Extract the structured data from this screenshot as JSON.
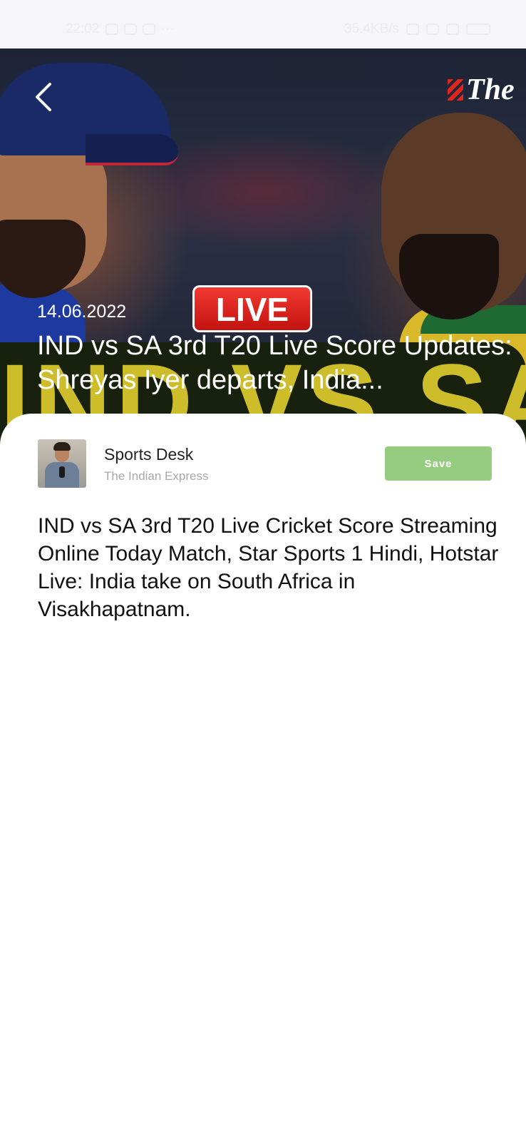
{
  "status_bar": {
    "time": "22:02",
    "more_indicator": "···",
    "net_speed": "35.4KB/s",
    "icons": [
      "whatsapp-icon",
      "game-icon",
      "message-icon",
      "alarm-icon",
      "signal-icon",
      "wifi-icon",
      "battery-icon"
    ]
  },
  "hero": {
    "logo_text": "The",
    "live_badge": "LIVE",
    "band_text": "IND VS SA",
    "date": "14.06.2022",
    "title": "IND vs SA 3rd T20 Live Score Updates: Shreyas Iyer departs, India..."
  },
  "author": {
    "name": "Sports Desk",
    "source": "The Indian Express"
  },
  "actions": {
    "save_label": "Save"
  },
  "article": {
    "body": "IND vs SA 3rd T20 Live Cricket Score Streaming Online Today Match, Star Sports 1 Hindi, Hotstar Live: India take on South Africa in Visakhapatnam."
  },
  "colors": {
    "save_button": "#96cc80",
    "live_badge": "#d81e18",
    "band": "#d8c62c"
  }
}
